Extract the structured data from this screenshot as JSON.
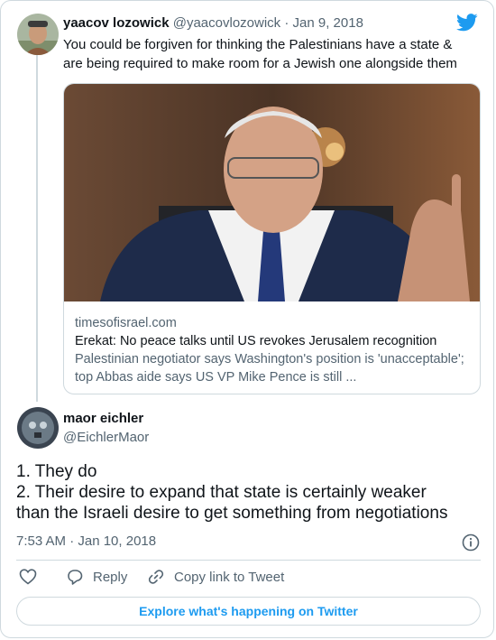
{
  "parent_tweet": {
    "author_name": "yaacov lozowick",
    "author_handle": "@yaacovlozowick",
    "separator": "·",
    "date": "Jan 9, 2018",
    "text": "You could be forgiven for thinking the Palestinians have a state & are being required to make room for a Jewish one alongside them",
    "link_card": {
      "domain": "timesofisrael.com",
      "title": "Erekat: No peace talks until US revokes Jerusalem recognition",
      "description": "Palestinian negotiator says Washington's position is 'unacceptable'; top Abbas aide says US VP Mike Pence is still ..."
    }
  },
  "reply_tweet": {
    "author_name": "maor eichler",
    "author_handle": "@EichlerMaor",
    "text_lines": [
      "1. They do",
      "2. Their desire to expand that state is certainly weaker",
      "than the Israeli desire to get something from negotiations"
    ],
    "timestamp": "7:53 AM · Jan 10, 2018"
  },
  "actions": {
    "reply_label": "Reply",
    "copy_label": "Copy link to Tweet"
  },
  "explore_label": "Explore what's happening on Twitter",
  "icons": [
    "twitter-bird-icon",
    "heart-icon",
    "reply-icon",
    "link-icon",
    "info-icon"
  ],
  "colors": {
    "accent": "#1d9bf0",
    "text": "#0f1419",
    "muted": "#536471",
    "border": "#cfd9de"
  }
}
